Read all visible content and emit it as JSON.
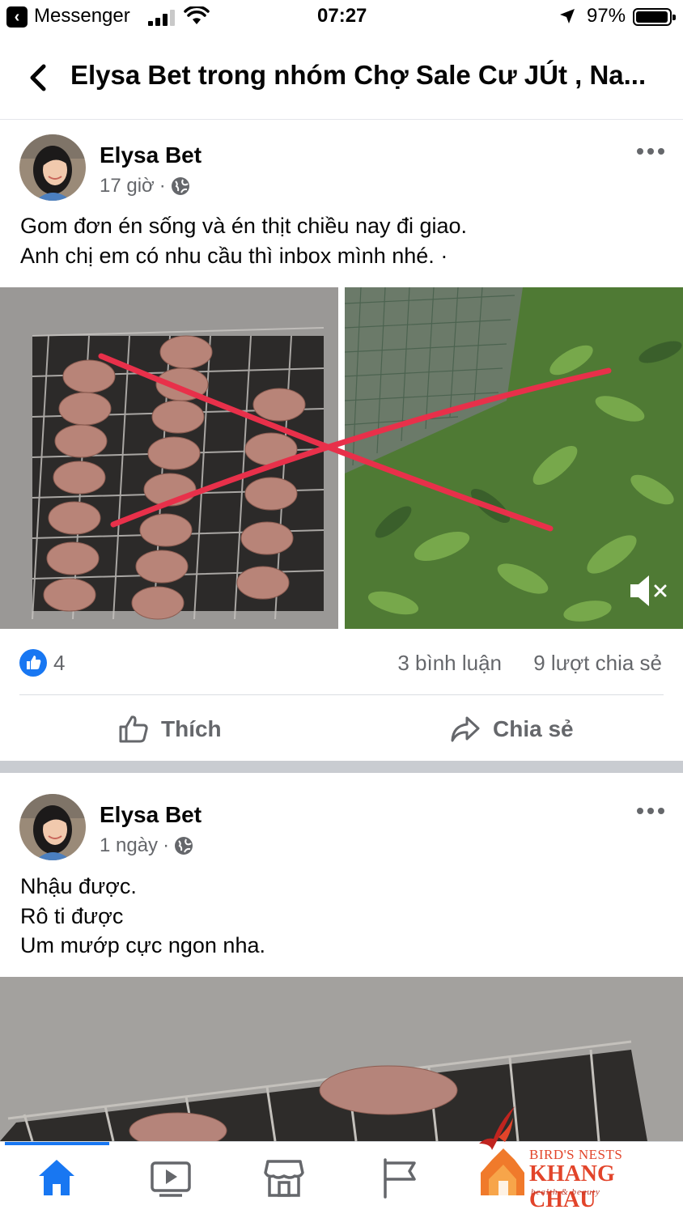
{
  "status_bar": {
    "back_app_label": "Messenger",
    "time": "07:27",
    "battery_percent": "97%",
    "battery_level": 0.97,
    "signal_bars_active": 3,
    "signal_bars_total": 4
  },
  "header": {
    "title": "Elysa Bet trong nhóm Chợ Sale Cư JÚt , Na..."
  },
  "posts": [
    {
      "author": "Elysa Bet",
      "time": "17 giờ",
      "privacy_icon": "globe-icon",
      "text_lines": [
        "Gom đơn én sống và én thịt chiều nay đi giao.",
        "Anh chị em có nhu cầu thì inbox mình nhé.        ·"
      ],
      "reactions": {
        "like_count": "4",
        "comments": "3 bình luận",
        "shares": "9 lượt chia sẻ"
      },
      "actions": {
        "like_label": "Thích",
        "share_label": "Chia sẻ"
      }
    },
    {
      "author": "Elysa Bet",
      "time": "1 ngày",
      "privacy_icon": "globe-icon",
      "text_lines": [
        "Nhậu được.",
        "Rô ti được",
        "Um mướp cực ngon nha."
      ]
    }
  ],
  "tabbar": {
    "tabs": [
      "home-icon",
      "video-icon",
      "marketplace-icon",
      "pages-flag-icon"
    ],
    "active": "home-icon"
  },
  "watermark": {
    "line1": "BIRD'S NESTS",
    "line2": "KHANG CHAU",
    "line3": "health & beauty"
  },
  "colors": {
    "accent": "#1877f2",
    "secondary_text": "#65676b",
    "cross_mark": "#e8304a"
  }
}
